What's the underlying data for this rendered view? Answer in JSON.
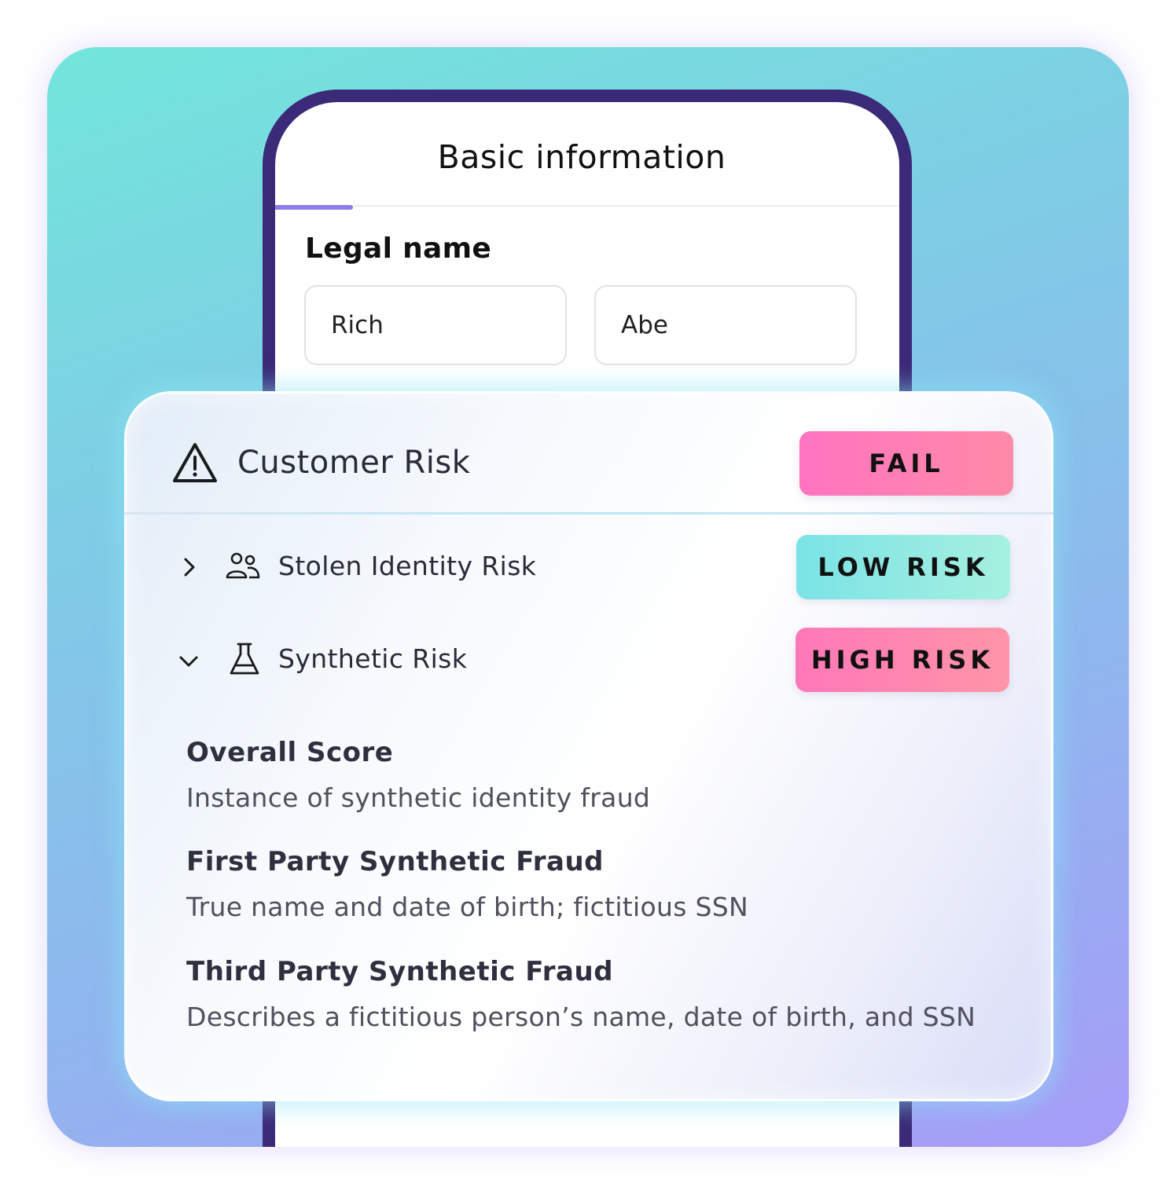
{
  "phone": {
    "title": "Basic information",
    "section_label": "Legal name",
    "first_name_value": "Rich",
    "last_name_value": "Abe",
    "progress": 0.125
  },
  "risk_panel": {
    "title": "Customer Risk",
    "title_icon": "warning-triangle-icon",
    "status": "FAIL",
    "rows": [
      {
        "label": "Stolen Identity Risk",
        "icon": "people-icon",
        "chevron": "chevron-right-icon",
        "expanded": false,
        "badge": "LOW RISK"
      },
      {
        "label": "Synthetic Risk",
        "icon": "flask-icon",
        "chevron": "chevron-down-icon",
        "expanded": true,
        "badge": "HIGH RISK"
      }
    ],
    "details": [
      {
        "heading": "Overall Score",
        "text": "Instance of synthetic identity fraud"
      },
      {
        "heading": "First Party Synthetic Fraud",
        "text": "True name and date of birth; fictitious SSN"
      },
      {
        "heading": "Third Party Synthetic Fraud",
        "text": "Describes a fictitious person’s name, date of birth, and SSN"
      }
    ]
  },
  "colors": {
    "phone_frame": "#3b2a78",
    "progress_accent": "#8d7de8",
    "fail_badge": "#ff74c0",
    "low_risk_badge": "#7be3e6",
    "high_risk_badge": "#ff78b8"
  }
}
